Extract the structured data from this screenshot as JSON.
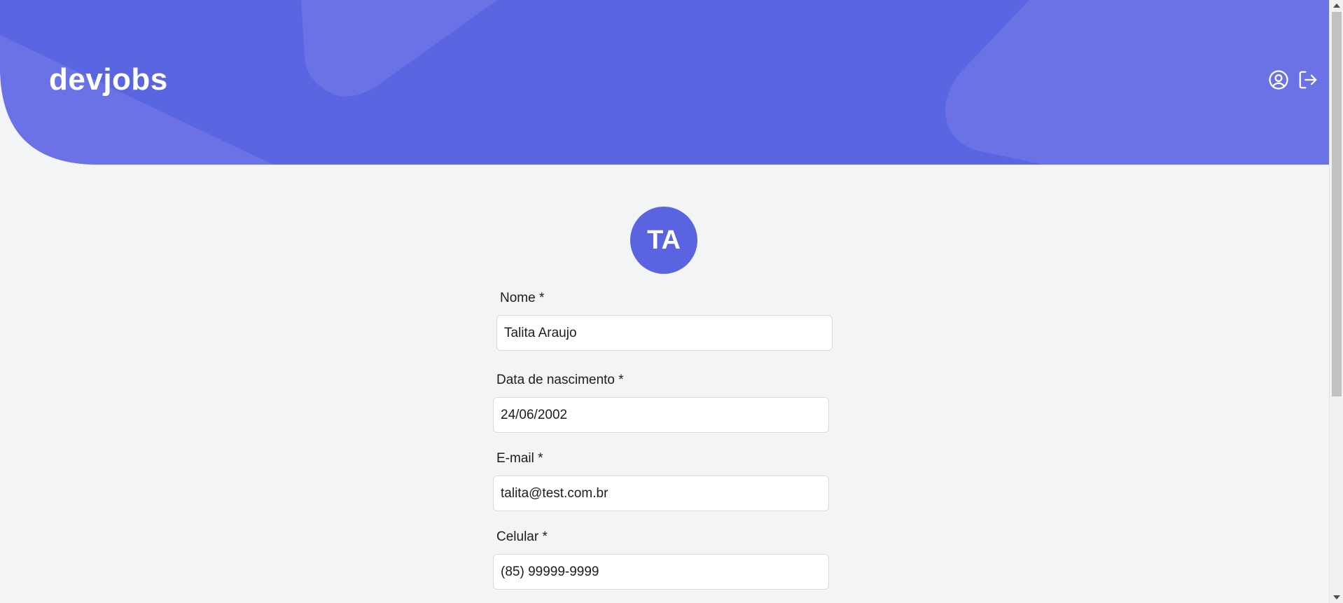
{
  "header": {
    "logo": "devjobs",
    "colors": {
      "primary": "#5a64e0",
      "primary_light": "#6a72e6"
    },
    "icons": [
      "user-circle-icon",
      "logout-icon"
    ]
  },
  "profile": {
    "avatar_initials": "TA"
  },
  "form": {
    "fields": [
      {
        "label": "Nome *",
        "value": "Talita Araujo"
      },
      {
        "label": "Data de nascimento *",
        "value": "24/06/2002"
      },
      {
        "label": "E-mail *",
        "value": "talita@test.com.br"
      },
      {
        "label": "Celular *",
        "value": "(85) 99999-9999"
      }
    ]
  }
}
